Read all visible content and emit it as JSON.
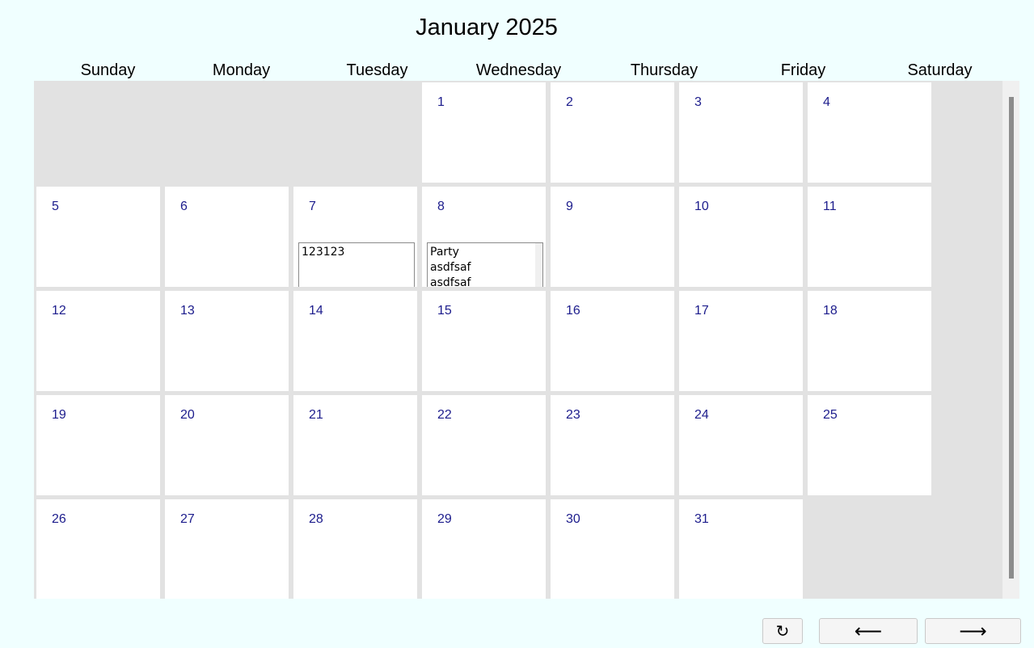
{
  "calendar": {
    "title": "January 2025",
    "weekdays": [
      "Sunday",
      "Monday",
      "Tuesday",
      "Wednesday",
      "Thursday",
      "Friday",
      "Saturday"
    ],
    "weeks": [
      [
        null,
        null,
        null,
        {
          "day": "1"
        },
        {
          "day": "2"
        },
        {
          "day": "3"
        },
        {
          "day": "4"
        }
      ],
      [
        {
          "day": "5"
        },
        {
          "day": "6"
        },
        {
          "day": "7",
          "events": [
            "123123"
          ]
        },
        {
          "day": "8",
          "events": [
            "Party",
            "asdfsaf",
            "asdfsaf"
          ],
          "scroll": true
        },
        {
          "day": "9"
        },
        {
          "day": "10"
        },
        {
          "day": "11"
        }
      ],
      [
        {
          "day": "12"
        },
        {
          "day": "13"
        },
        {
          "day": "14"
        },
        {
          "day": "15"
        },
        {
          "day": "16"
        },
        {
          "day": "17"
        },
        {
          "day": "18"
        }
      ],
      [
        {
          "day": "19"
        },
        {
          "day": "20"
        },
        {
          "day": "21"
        },
        {
          "day": "22"
        },
        {
          "day": "23"
        },
        {
          "day": "24"
        },
        {
          "day": "25"
        }
      ],
      [
        {
          "day": "26"
        },
        {
          "day": "27"
        },
        {
          "day": "28"
        },
        {
          "day": "29"
        },
        {
          "day": "30"
        },
        {
          "day": "31"
        },
        null
      ]
    ]
  },
  "controls": {
    "refresh_icon": "refresh-icon",
    "refresh_label": "↻",
    "prev_icon": "arrow-left-icon",
    "prev_label": "⟵",
    "next_icon": "arrow-right-icon",
    "next_label": "⟶"
  },
  "colors": {
    "background": "#f0ffff",
    "day_number": "#1c1c8c",
    "empty_cell": "#e2e2e2"
  }
}
